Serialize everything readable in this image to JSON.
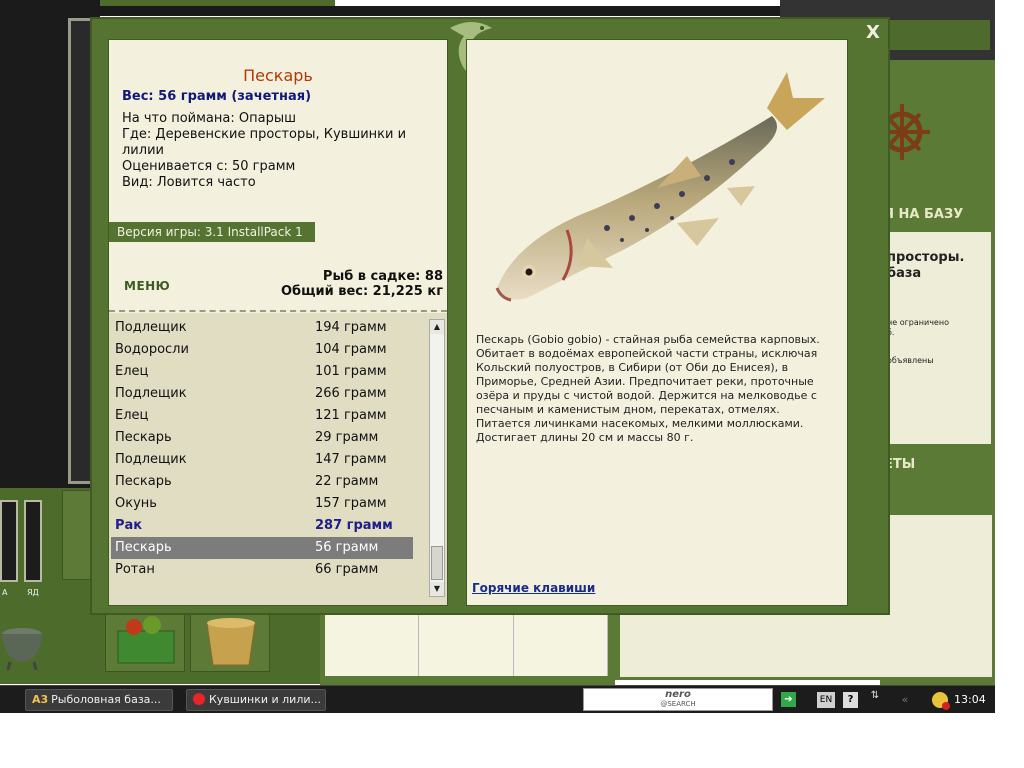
{
  "fish": {
    "name": "Пескарь",
    "weight": "Вес: 56 грамм (зачетная)",
    "info": [
      "На что поймана: Опарыш",
      "Где: Деревенские просторы, Кувшинки и лилии",
      "Оценивается с: 50 грамм",
      "Вид: Ловится часто"
    ],
    "description": "Пескарь (Gobio gobio) - стайная рыба семейства карповых. Обитает в водоёмах европейской части страны, исключая Кольский полуостров, в Сибири (от Оби до Енисея), в Приморье, Средней Азии. Предпочитает реки, проточные озёра и пруды с чистой водой. Держится на мелководье с песчаным и каменистым дном, перекатах, отмелях. Питается личинками насекомых, мелкими моллюсками. Достигает длины 20 см и массы 80 г."
  },
  "version_label": "Версия игры: 3.1 InstallPack 1",
  "menu_label": "МЕНЮ",
  "stats": {
    "count": "Рыб в садке: 88",
    "total_weight": "Общий вес: 21,225 кг"
  },
  "catch_list": [
    {
      "name": "Подлещик",
      "weight": "194 грамм"
    },
    {
      "name": "Водоросли",
      "weight": "104 грамм"
    },
    {
      "name": "Елец",
      "weight": "101 грамм"
    },
    {
      "name": "Подлещик",
      "weight": "266 грамм"
    },
    {
      "name": "Елец",
      "weight": "121 грамм"
    },
    {
      "name": "Пескарь",
      "weight": "29 грамм"
    },
    {
      "name": "Подлещик",
      "weight": "147 грамм"
    },
    {
      "name": "Пескарь",
      "weight": "22 грамм"
    },
    {
      "name": "Окунь",
      "weight": "157 грамм"
    },
    {
      "name": "Рак",
      "weight": "287 грамм"
    },
    {
      "name": "Пескарь",
      "weight": "56 грамм"
    },
    {
      "name": "Ротан",
      "weight": "66 грамм"
    }
  ],
  "hotkeys_label": "Горячие клавиши",
  "close_label": "X",
  "background": {
    "base_label": "Я НА БАЗУ",
    "card_big": "просторы.\nбаза",
    "card_small1": "не ограничено\nб.",
    "card_small2": "объявлены",
    "secrets_label": "ЕТЫ",
    "meter_label_1": "А",
    "meter_label_2": "ЯД"
  },
  "taskbar": {
    "task1": "Рыболовная база...",
    "task1_icon": "А3",
    "task2": "Кувшинки и лили...",
    "search_brand": "nero",
    "search_sub": "@SEARCH",
    "lang": "EN",
    "clock": "13:04"
  },
  "colors": {
    "panel_green": "#557431",
    "card_bg": "#f3f1de",
    "title_orange": "#b23a06",
    "weight_blue": "#10197a"
  }
}
